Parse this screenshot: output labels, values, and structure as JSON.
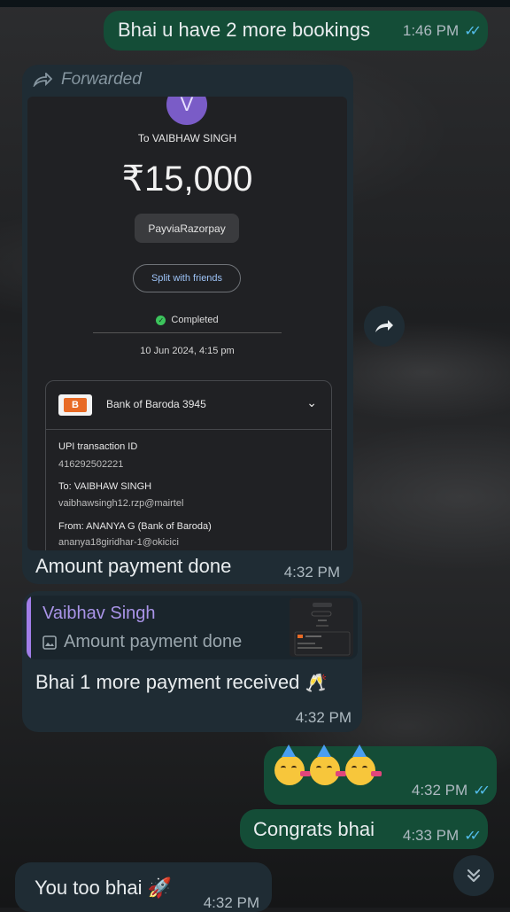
{
  "messages": {
    "m1": {
      "text": "Bhai u have 2 more bookings",
      "time": "1:46 PM"
    },
    "m2": {
      "forwarded_label": "Forwarded",
      "caption": "Amount payment done",
      "time": "4:32 PM",
      "screenshot": {
        "avatar_letter": "V",
        "to": "To VAIBHAW SINGH",
        "amount": "₹15,000",
        "pay_chip": "PayviaRazorpay",
        "split_button": "Split with friends",
        "status": "Completed",
        "datetime": "10 Jun 2024, 4:15 pm",
        "bank": "Bank of Baroda 3945",
        "upi_label": "UPI transaction ID",
        "upi_id": "416292502221",
        "to_label": "To: VAIBHAW SINGH",
        "to_vpa": "vaibhawsingh12.rzp@mairtel",
        "from_label": "From: ANANYA G (Bank of Baroda)",
        "from_vpa": "ananya18giridhar-1@okicici"
      }
    },
    "m3": {
      "quote_author": "Vaibhav Singh",
      "quote_text": "Amount payment done",
      "text": "Bhai 1 more payment received",
      "time": "4:32 PM"
    },
    "m4": {
      "time": "4:32 PM"
    },
    "m5": {
      "text": "Congrats bhai",
      "time": "4:33 PM"
    },
    "m6": {
      "text": "You too bhai",
      "time": "4:32 PM"
    }
  },
  "colors": {
    "outgoing_bubble": "#144d37",
    "incoming_bubble": "#1f2c34",
    "read_ticks": "#53bdeb",
    "quote_author": "#a994e8"
  },
  "icons": [
    "forward-icon",
    "double-check-icon",
    "image-icon",
    "clinking-glasses-emoji",
    "partying-face-emoji",
    "rocket-emoji",
    "scroll-down-icon"
  ]
}
